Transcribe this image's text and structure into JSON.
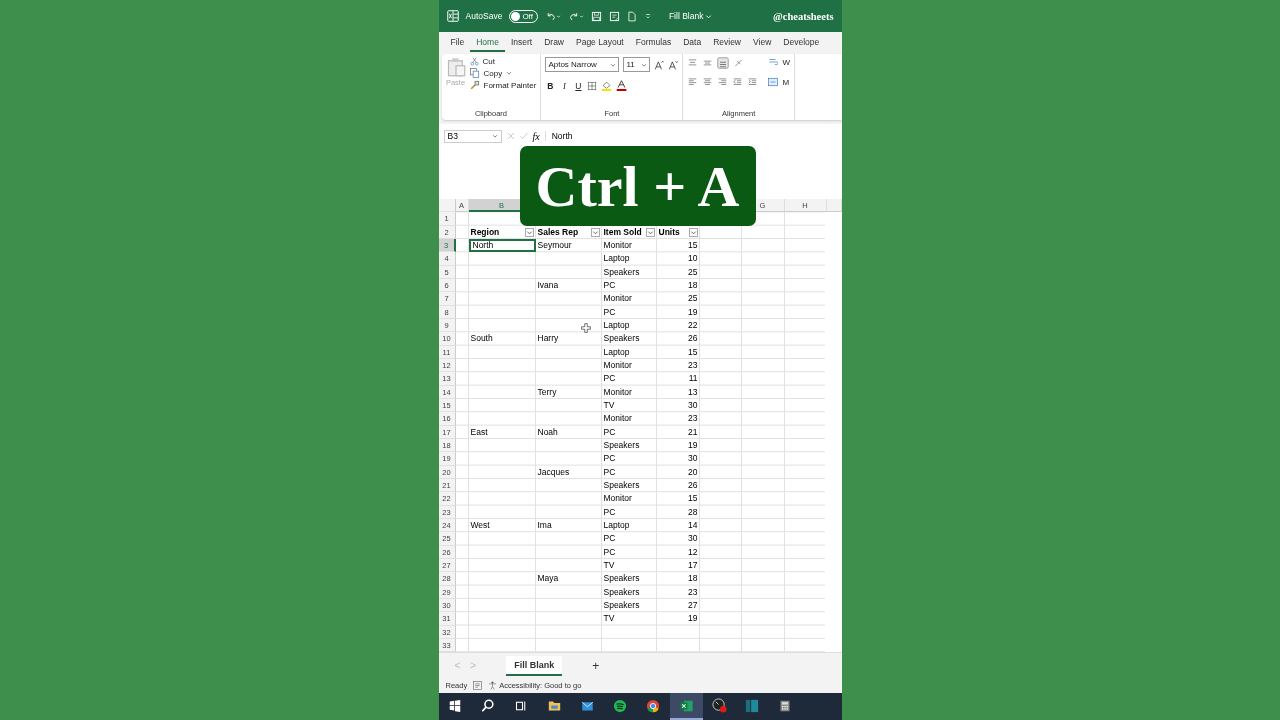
{
  "title_bar": {
    "autosave_label": "AutoSave",
    "autosave": {
      "on": false,
      "label": "Off"
    },
    "document": "Fill Blank",
    "handle": "@cheatsheets"
  },
  "menu_tabs": [
    {
      "label": "File",
      "selected": false
    },
    {
      "label": "Home",
      "selected": true
    },
    {
      "label": "Insert",
      "selected": false
    },
    {
      "label": "Draw",
      "selected": false
    },
    {
      "label": "Page Layout",
      "selected": false
    },
    {
      "label": "Formulas",
      "selected": false
    },
    {
      "label": "Data",
      "selected": false
    },
    {
      "label": "Review",
      "selected": false
    },
    {
      "label": "View",
      "selected": false
    },
    {
      "label": "Develope",
      "selected": false
    }
  ],
  "ribbon": {
    "clipboard": {
      "paste": "Paste",
      "cut": "Cut",
      "copy": "Copy",
      "format_painter": "Format Painter",
      "label": "Clipboard"
    },
    "font": {
      "name": "Aptos Narrow",
      "size": "11",
      "bold": "B",
      "italic": "I",
      "underline": "U",
      "label": "Font"
    },
    "alignment": {
      "label": "Alignment",
      "wrap": "W",
      "merge": "M"
    }
  },
  "formula_bar": {
    "name_box": "B3",
    "fx": "fx",
    "value": "North"
  },
  "overlay": {
    "text": "Ctrl + A"
  },
  "column_headers_left": [
    {
      "label": "A",
      "selected": false
    },
    {
      "label": "B",
      "selected": true
    }
  ],
  "column_headers_right": [
    {
      "label": "G",
      "selected": false
    },
    {
      "label": "H",
      "selected": false
    }
  ],
  "rows": [
    {
      "number": "1",
      "selected": false,
      "kind": "empty"
    },
    {
      "number": "2",
      "selected": false,
      "kind": "header",
      "cells": [
        "Region",
        "Sales Rep",
        "Item Sold",
        "Units"
      ]
    },
    {
      "number": "3",
      "selected": true,
      "kind": "data",
      "cells": [
        "North",
        "Seymour",
        "Monitor",
        "15"
      ]
    },
    {
      "number": "4",
      "selected": false,
      "kind": "data",
      "cells": [
        null,
        null,
        "Laptop",
        "10"
      ]
    },
    {
      "number": "5",
      "selected": false,
      "kind": "data",
      "cells": [
        null,
        null,
        "Speakers",
        "25"
      ]
    },
    {
      "number": "6",
      "selected": false,
      "kind": "data",
      "cells": [
        null,
        "Ivana",
        "PC",
        "18"
      ]
    },
    {
      "number": "7",
      "selected": false,
      "kind": "data",
      "cells": [
        null,
        null,
        "Monitor",
        "25"
      ]
    },
    {
      "number": "8",
      "selected": false,
      "kind": "data",
      "cells": [
        null,
        null,
        "PC",
        "19"
      ]
    },
    {
      "number": "9",
      "selected": false,
      "kind": "data",
      "cells": [
        null,
        null,
        "Laptop",
        "22"
      ]
    },
    {
      "number": "10",
      "selected": false,
      "kind": "data",
      "cells": [
        "South",
        "Harry",
        "Speakers",
        "26"
      ]
    },
    {
      "number": "11",
      "selected": false,
      "kind": "data",
      "cells": [
        null,
        null,
        "Laptop",
        "15"
      ]
    },
    {
      "number": "12",
      "selected": false,
      "kind": "data",
      "cells": [
        null,
        null,
        "Monitor",
        "23"
      ]
    },
    {
      "number": "13",
      "selected": false,
      "kind": "data",
      "cells": [
        null,
        null,
        "PC",
        "11"
      ]
    },
    {
      "number": "14",
      "selected": false,
      "kind": "data",
      "cells": [
        null,
        "Terry",
        "Monitor",
        "13"
      ]
    },
    {
      "number": "15",
      "selected": false,
      "kind": "data",
      "cells": [
        null,
        null,
        "TV",
        "30"
      ]
    },
    {
      "number": "16",
      "selected": false,
      "kind": "data",
      "cells": [
        null,
        null,
        "Monitor",
        "23"
      ]
    },
    {
      "number": "17",
      "selected": false,
      "kind": "data",
      "cells": [
        "East",
        "Noah",
        "PC",
        "21"
      ]
    },
    {
      "number": "18",
      "selected": false,
      "kind": "data",
      "cells": [
        null,
        null,
        "Speakers",
        "19"
      ]
    },
    {
      "number": "19",
      "selected": false,
      "kind": "data",
      "cells": [
        null,
        null,
        "PC",
        "30"
      ]
    },
    {
      "number": "20",
      "selected": false,
      "kind": "data",
      "cells": [
        null,
        "Jacques",
        "PC",
        "20"
      ]
    },
    {
      "number": "21",
      "selected": false,
      "kind": "data",
      "cells": [
        null,
        null,
        "Speakers",
        "26"
      ]
    },
    {
      "number": "22",
      "selected": false,
      "kind": "data",
      "cells": [
        null,
        null,
        "Monitor",
        "15"
      ]
    },
    {
      "number": "23",
      "selected": false,
      "kind": "data",
      "cells": [
        null,
        null,
        "PC",
        "28"
      ]
    },
    {
      "number": "24",
      "selected": false,
      "kind": "data",
      "cells": [
        "West",
        "Ima",
        "Laptop",
        "14"
      ]
    },
    {
      "number": "25",
      "selected": false,
      "kind": "data",
      "cells": [
        null,
        null,
        "PC",
        "30"
      ]
    },
    {
      "number": "26",
      "selected": false,
      "kind": "data",
      "cells": [
        null,
        null,
        "PC",
        "12"
      ]
    },
    {
      "number": "27",
      "selected": false,
      "kind": "data",
      "cells": [
        null,
        null,
        "TV",
        "17"
      ]
    },
    {
      "number": "28",
      "selected": false,
      "kind": "data",
      "cells": [
        null,
        "Maya",
        "Speakers",
        "18"
      ]
    },
    {
      "number": "29",
      "selected": false,
      "kind": "data",
      "cells": [
        null,
        null,
        "Speakers",
        "23"
      ]
    },
    {
      "number": "30",
      "selected": false,
      "kind": "data",
      "cells": [
        null,
        null,
        "Speakers",
        "27"
      ]
    },
    {
      "number": "31",
      "selected": false,
      "kind": "data",
      "cells": [
        null,
        null,
        "TV",
        "19"
      ]
    },
    {
      "number": "32",
      "selected": false,
      "kind": "empty"
    },
    {
      "number": "33",
      "selected": false,
      "kind": "empty"
    }
  ],
  "sheet_tabs": {
    "prev": "<",
    "next": ">",
    "tabs": [
      {
        "label": "Fill Blank",
        "selected": true
      }
    ],
    "add": "+"
  },
  "status_bar": {
    "status": "Ready",
    "accessibility": "Accessibility: Good to go"
  },
  "taskbar": [
    {
      "kind": "start",
      "active": false
    },
    {
      "kind": "search",
      "active": false
    },
    {
      "kind": "taskview",
      "active": false
    },
    {
      "kind": "folder",
      "active": false
    },
    {
      "kind": "mail",
      "active": false
    },
    {
      "kind": "music",
      "active": false
    },
    {
      "kind": "browser",
      "active": false
    },
    {
      "kind": "sheet",
      "active": true
    },
    {
      "kind": "recorder",
      "active": false
    },
    {
      "kind": "panel",
      "active": false
    },
    {
      "kind": "calculator",
      "active": false
    }
  ]
}
